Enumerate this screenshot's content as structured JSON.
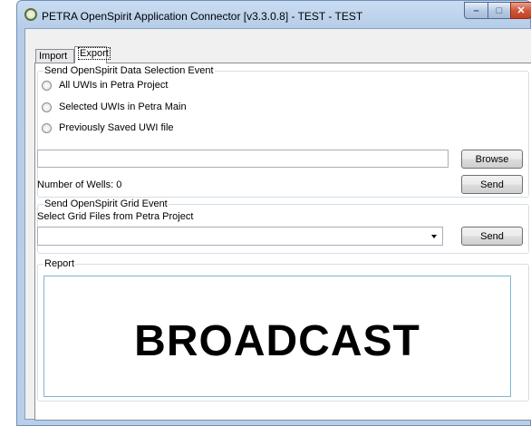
{
  "window": {
    "title": "PETRA OpenSpirit Application Connector [v3.3.0.8] - TEST - TEST",
    "min_glyph": "–",
    "max_glyph": "□",
    "close_glyph": "✕"
  },
  "tabs": [
    {
      "label": "Import",
      "selected": false
    },
    {
      "label": "Export",
      "selected": true
    }
  ],
  "selection_event": {
    "legend": "Send OpenSpirit Data Selection Event",
    "options": [
      {
        "label": "All UWIs in Petra Project",
        "checked": false
      },
      {
        "label": "Selected UWIs in Petra Main",
        "checked": false
      },
      {
        "label": "Previously Saved UWI file",
        "checked": false
      }
    ],
    "file_path_value": "",
    "browse_label": "Browse",
    "wells_label": "Number of Wells: 0",
    "send_label": "Send"
  },
  "grid_event": {
    "legend": "Send OpenSpirit Grid Event",
    "instruction": "Select Grid Files from Petra Project",
    "combo_value": "",
    "send_label": "Send"
  },
  "report": {
    "legend": "Report",
    "text": "BROADCAST"
  }
}
